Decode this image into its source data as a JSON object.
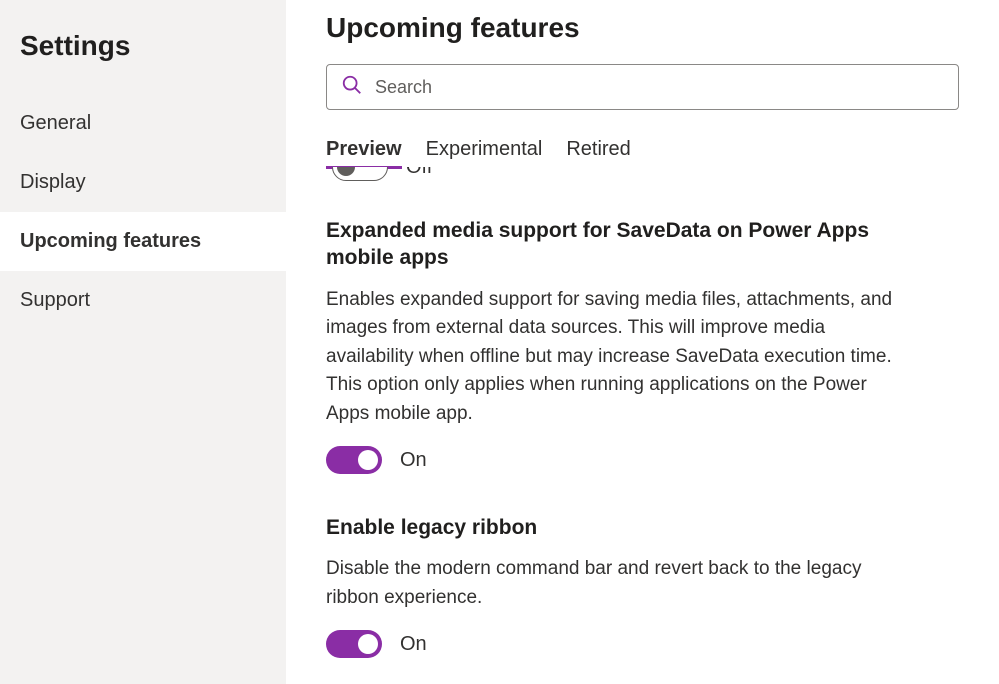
{
  "colors": {
    "accent": "#8a2da5"
  },
  "sidebar": {
    "title": "Settings",
    "items": [
      {
        "label": "General",
        "active": false
      },
      {
        "label": "Display",
        "active": false
      },
      {
        "label": "Upcoming features",
        "active": true
      },
      {
        "label": "Support",
        "active": false
      }
    ]
  },
  "header": {
    "page_title": "Upcoming features",
    "search_placeholder": "Search"
  },
  "tabs": [
    {
      "label": "Preview",
      "active": true
    },
    {
      "label": "Experimental",
      "active": false
    },
    {
      "label": "Retired",
      "active": false
    }
  ],
  "partial_feature": {
    "state_label": "Off",
    "on": false
  },
  "features": [
    {
      "title": "Expanded media support for SaveData on Power Apps mobile apps",
      "description": "Enables expanded support for saving media files, attachments, and images from external data sources. This will improve media availability when offline but may increase SaveData execution time. This option only applies when running applications on the Power Apps mobile app.",
      "on": true,
      "state_label": "On"
    },
    {
      "title": "Enable legacy ribbon",
      "description": "Disable the modern command bar and revert back to the legacy ribbon experience.",
      "on": true,
      "state_label": "On"
    }
  ]
}
